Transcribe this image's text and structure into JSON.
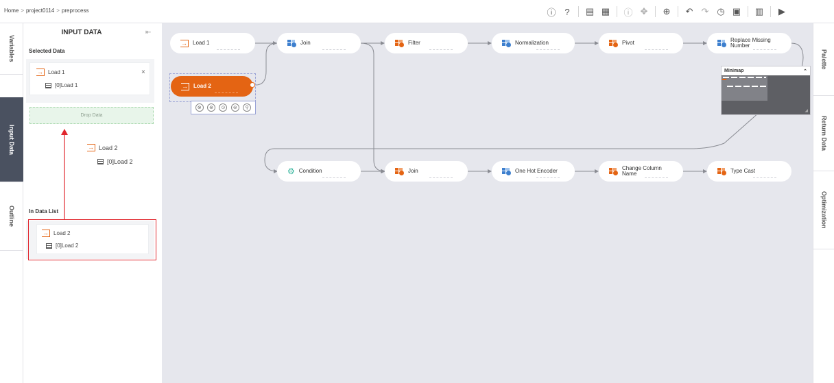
{
  "breadcrumb": [
    "Home",
    "project0114",
    "preprocess"
  ],
  "toolbar": [
    {
      "name": "info-icon",
      "glyph": "ⓘ"
    },
    {
      "name": "help-icon",
      "glyph": "?"
    },
    {
      "sep": true
    },
    {
      "name": "script-icon",
      "glyph": "▤"
    },
    {
      "name": "schedule-icon",
      "glyph": "▦"
    },
    {
      "sep": true
    },
    {
      "name": "run-info-icon",
      "glyph": "ⓘ",
      "dim": true
    },
    {
      "name": "move-icon",
      "glyph": "✥",
      "dim": true
    },
    {
      "sep": true
    },
    {
      "name": "zoom-icon",
      "glyph": "⊕"
    },
    {
      "sep": true
    },
    {
      "name": "undo-icon",
      "glyph": "↶"
    },
    {
      "name": "redo-icon",
      "glyph": "↷",
      "dim": true
    },
    {
      "name": "history-icon",
      "glyph": "◷"
    },
    {
      "name": "clipboard-icon",
      "glyph": "▣"
    },
    {
      "sep": true
    },
    {
      "name": "calendar-icon",
      "glyph": "▥"
    },
    {
      "sep": true
    },
    {
      "name": "play-icon",
      "glyph": "▶"
    }
  ],
  "left_tabs": [
    "Variables",
    "Input Data",
    "Outline"
  ],
  "panel": {
    "title": "INPUT DATA",
    "collapse_glyph": "⇤",
    "selected_title": "Selected Data",
    "selected": {
      "name": "Load 1",
      "table": "[0]Load 1"
    },
    "drop_label": "Drop Data",
    "drag": {
      "name": "Load 2",
      "table": "[0]Load 2"
    },
    "list_title": "In Data List",
    "list_item": {
      "name": "Load 2",
      "table": "[0]Load 2"
    }
  },
  "nodes": {
    "load1": "Load 1",
    "join1": "Join",
    "filter": "Filter",
    "normalization": "Normalization",
    "pivot": "Pivot",
    "replace": "Replace Missing\nNumber",
    "load2": "Load 2",
    "condition": "Condition",
    "join2": "Join",
    "onehot": "One Hot Encoder",
    "change": "Change Column\nName",
    "typecast": "Type Cast"
  },
  "node_tools": [
    "⊗",
    "⊛",
    "⊙",
    "⊜",
    "⚲"
  ],
  "minimap": {
    "title": "Minimap",
    "toggle": "⌃"
  },
  "right_tabs": [
    "Palette",
    "Return Data",
    "Optimization"
  ],
  "colors": {
    "accent": "#e46413",
    "active_tab": "#4a5160",
    "canvas": "#e6e7ed",
    "highlight": "#e1262d",
    "drop_zone": "#e8f5ea"
  }
}
